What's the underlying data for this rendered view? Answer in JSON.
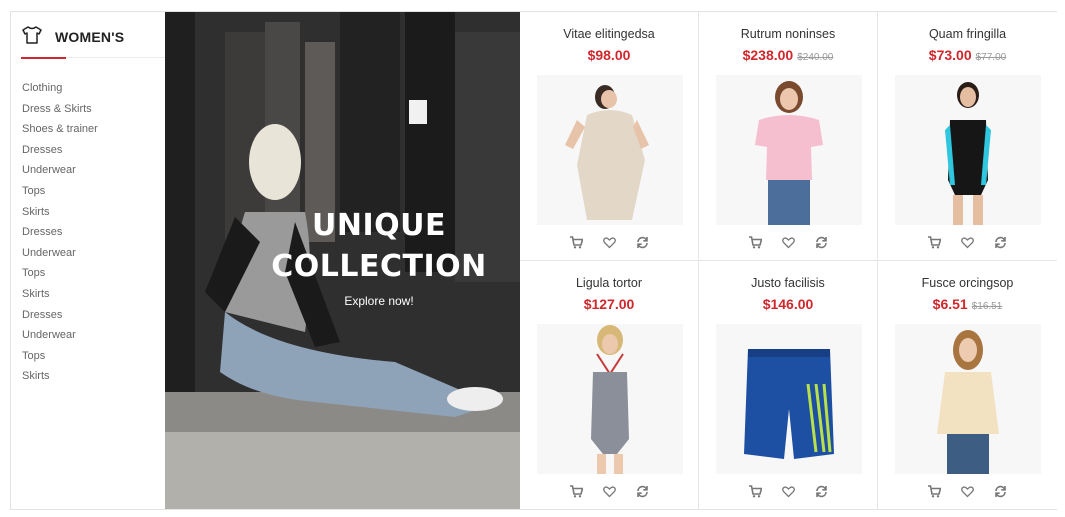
{
  "sidebar": {
    "title": "WOMEN'S",
    "icon": "tshirt-icon",
    "accent_color": "#d0272c",
    "items": [
      {
        "label": "Clothing"
      },
      {
        "label": "Dress & Skirts"
      },
      {
        "label": "Shoes & trainer"
      },
      {
        "label": "Dresses"
      },
      {
        "label": "Underwear"
      },
      {
        "label": "Tops"
      },
      {
        "label": "Skirts"
      },
      {
        "label": "Dresses"
      },
      {
        "label": "Underwear"
      },
      {
        "label": "Tops"
      },
      {
        "label": "Skirts"
      },
      {
        "label": "Dresses"
      },
      {
        "label": "Underwear"
      },
      {
        "label": "Tops"
      },
      {
        "label": "Skirts"
      }
    ]
  },
  "banner": {
    "line1": "UNIQUE",
    "line2": "COLLECTION",
    "cta": "Explore now!"
  },
  "products": [
    {
      "name": "Vitae elitingedsa",
      "price": "$98.00",
      "old_price": ""
    },
    {
      "name": "Rutrum noninses",
      "price": "$238.00",
      "old_price": "$240.00"
    },
    {
      "name": "Quam fringilla",
      "price": "$73.00",
      "old_price": "$77.00"
    },
    {
      "name": "Ligula tortor",
      "price": "$127.00",
      "old_price": ""
    },
    {
      "name": "Justo facilisis",
      "price": "$146.00",
      "old_price": ""
    },
    {
      "name": "Fusce orcingsop",
      "price": "$6.51",
      "old_price": "$16.51"
    }
  ],
  "action_icons": [
    "cart-icon",
    "heart-icon",
    "compare-icon"
  ],
  "colors": {
    "price": "#d0272c",
    "old_price": "#999999"
  }
}
